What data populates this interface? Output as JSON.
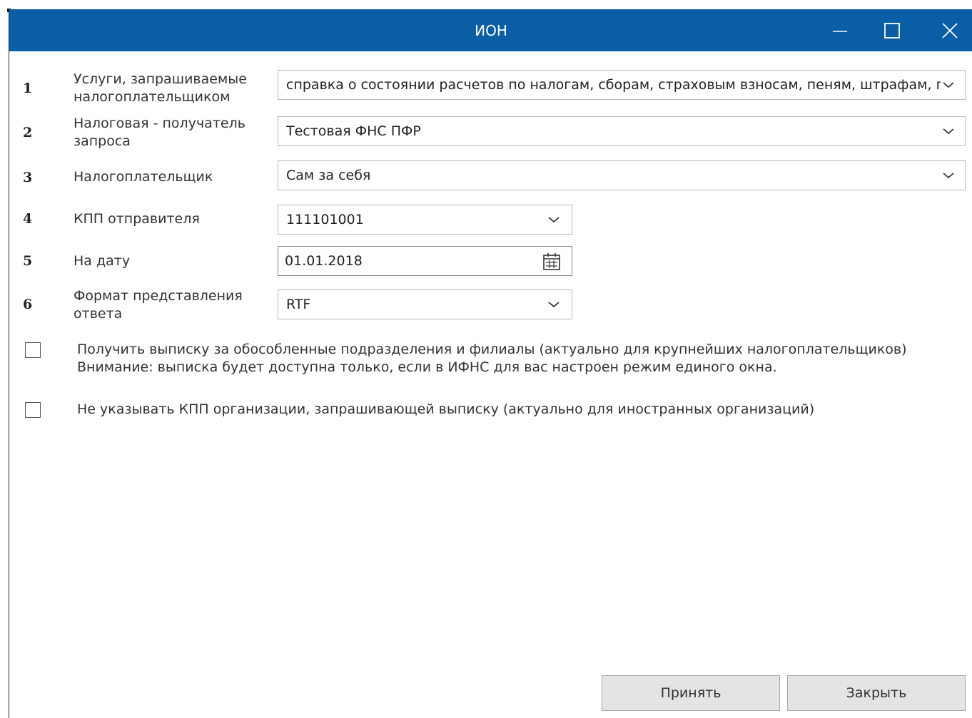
{
  "window": {
    "title": "ИОН"
  },
  "rows": [
    {
      "num": "1",
      "label": "Услуги, запрашиваемые налогоплательщиком",
      "value": "справка о состоянии расчетов по налогам, сборам, страховым взносам, пеням, штрафам, пр"
    },
    {
      "num": "2",
      "label": "Налоговая - получатель запроса",
      "value": "Тестовая ФНС ПФР"
    },
    {
      "num": "3",
      "label": "Налогоплательщик",
      "value": "Сам за себя"
    },
    {
      "num": "4",
      "label": "КПП отправителя",
      "value": "111101001"
    },
    {
      "num": "5",
      "label": "На дату",
      "value": "01.01.2018"
    },
    {
      "num": "6",
      "label": "Формат представления ответа",
      "value": "RTF"
    }
  ],
  "checkboxes": [
    {
      "line1": "Получить выписку за обособленные подразделения и филиалы (актуально для крупнейших налогоплательщиков)",
      "line2": "Внимание: выписка будет доступна только, если в ИФНС для вас настроен режим единого окна.",
      "checked": false
    },
    {
      "line1": "Не указывать КПП организации, запрашивающей выписку (актуально для иностранных организаций)",
      "checked": false
    }
  ],
  "buttons": {
    "accept": "Принять",
    "close": "Закрыть"
  },
  "colors": {
    "titlebar": "#0a5ea6"
  }
}
